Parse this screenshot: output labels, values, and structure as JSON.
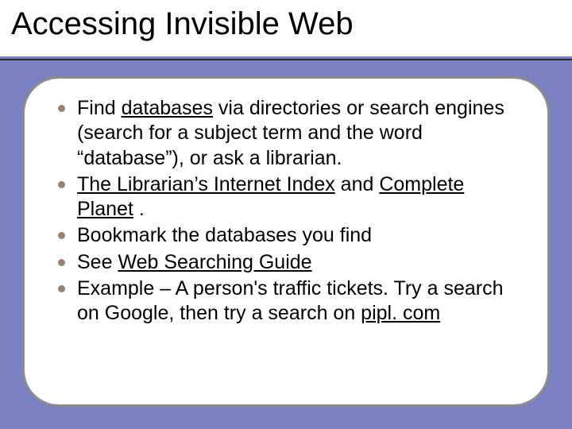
{
  "title": "Accessing Invisible Web",
  "bullets": {
    "b1": {
      "pre": "Find ",
      "link1": "databases",
      "post": " via directories or search engines (search for a subject term and the word “database”), or ask a librarian."
    },
    "b2": {
      "link1": "The Librarian’s Internet Index",
      "mid": " and ",
      "link2": "Complete Planet",
      "post": " ."
    },
    "b3": {
      "text": "Bookmark the databases you find"
    },
    "b4": {
      "pre": "See ",
      "link1": "Web Searching Guide"
    },
    "b5": {
      "pre": "Example – A person's traffic tickets. Try a search on Google, then try a search on ",
      "link1": "pipl. com"
    }
  }
}
